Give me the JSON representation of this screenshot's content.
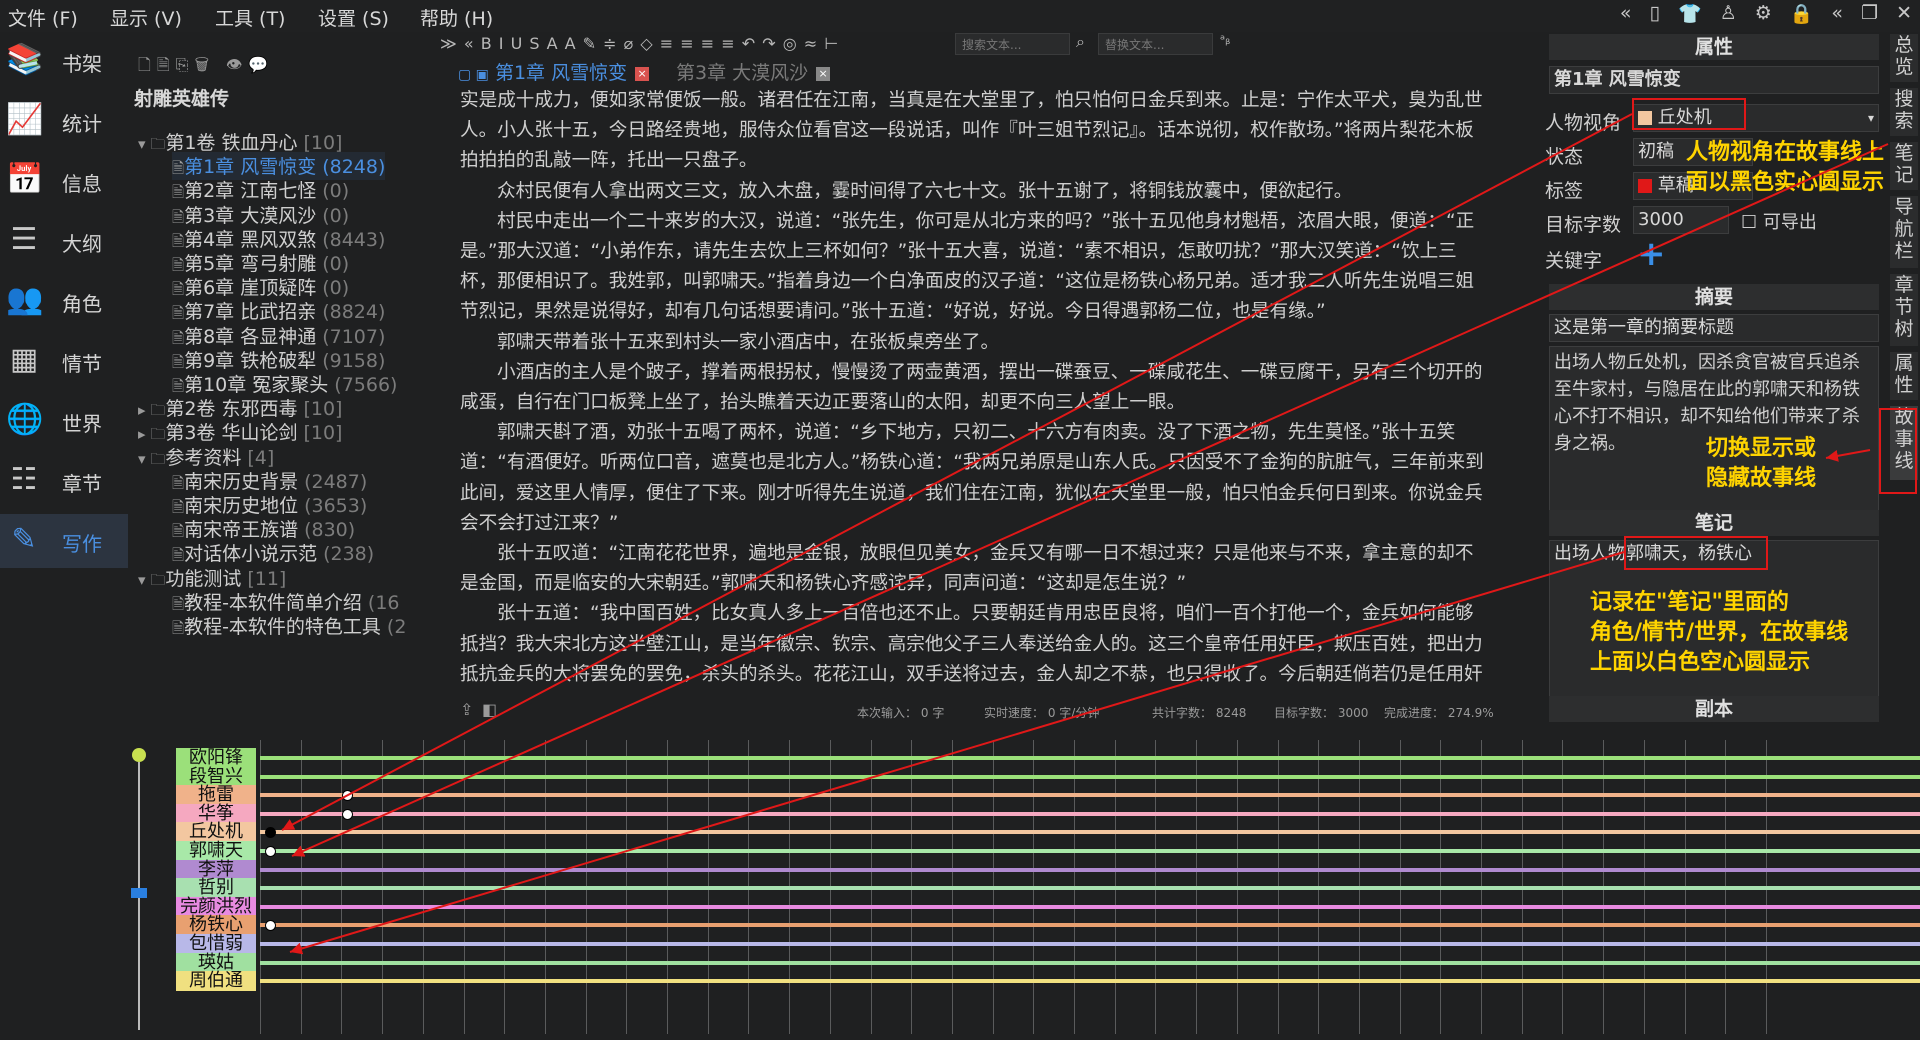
{
  "menu": [
    "文件 (F)",
    "显示 (V)",
    "工具 (T)",
    "设置 (S)",
    "帮助 (H)"
  ],
  "nav": [
    {
      "label": "书架",
      "icon": "bookshelf-icon",
      "glyph": "📚"
    },
    {
      "label": "统计",
      "icon": "chart-icon",
      "glyph": "📈"
    },
    {
      "label": "信息",
      "icon": "calendar-icon",
      "glyph": "📅"
    },
    {
      "label": "大纲",
      "icon": "outline-icon",
      "glyph": "☰"
    },
    {
      "label": "角色",
      "icon": "people-icon",
      "glyph": "👥"
    },
    {
      "label": "情节",
      "icon": "grid-icon",
      "glyph": "▦"
    },
    {
      "label": "世界",
      "icon": "globe-icon",
      "glyph": "🌐"
    },
    {
      "label": "章节",
      "icon": "list-icon",
      "glyph": "☷"
    },
    {
      "label": "写作",
      "icon": "pencil-icon",
      "glyph": "✎"
    }
  ],
  "tree": {
    "title": "射雕英雄传",
    "rows": [
      {
        "text": "第1卷 铁血丹心",
        "cnt": "[10]",
        "indent": 0,
        "arrow": "▾",
        "folder": true
      },
      {
        "text": "第1章 风雪惊变",
        "cnt": "(8248)",
        "indent": 1,
        "sel": true
      },
      {
        "text": "第2章 江南七怪",
        "cnt": "(0)",
        "indent": 1
      },
      {
        "text": "第3章 大漠风沙",
        "cnt": "(0)",
        "indent": 1
      },
      {
        "text": "第4章 黑风双煞",
        "cnt": "(8443)",
        "indent": 1
      },
      {
        "text": "第5章 弯弓射雕",
        "cnt": "(0)",
        "indent": 1
      },
      {
        "text": "第6章 崖顶疑阵",
        "cnt": "(0)",
        "indent": 1
      },
      {
        "text": "第7章 比武招亲",
        "cnt": "(8824)",
        "indent": 1
      },
      {
        "text": "第8章 各显神通",
        "cnt": "(7107)",
        "indent": 1
      },
      {
        "text": "第9章 铁枪破犁",
        "cnt": "(9158)",
        "indent": 1
      },
      {
        "text": "第10章 冤家聚头",
        "cnt": "(7566)",
        "indent": 1
      },
      {
        "text": "第2卷 东邪西毒",
        "cnt": "[10]",
        "indent": 0,
        "arrow": "▸",
        "folder": true
      },
      {
        "text": "第3卷 华山论剑",
        "cnt": "[10]",
        "indent": 0,
        "arrow": "▸",
        "folder": true
      },
      {
        "text": "参考资料",
        "cnt": "[4]",
        "indent": 0,
        "arrow": "▾",
        "folder": true
      },
      {
        "text": "南宋历史背景",
        "cnt": "(2487)",
        "indent": 1
      },
      {
        "text": "南宋历史地位",
        "cnt": "(3653)",
        "indent": 1
      },
      {
        "text": "南宋帝王族谱",
        "cnt": "(830)",
        "indent": 1
      },
      {
        "text": "对话体小说示范",
        "cnt": "(238)",
        "indent": 1
      },
      {
        "text": "功能测试",
        "cnt": "[11]",
        "indent": 0,
        "arrow": "▾",
        "folder": true
      },
      {
        "text": "教程-本软件简单介绍",
        "cnt": "(16",
        "indent": 1
      },
      {
        "text": "教程-本软件的特色工具",
        "cnt": "(2",
        "indent": 1
      }
    ]
  },
  "toolbar": {
    "glyphs": "≫  «  B  I  U  S  A  A  ✎  ≑  ⌀  ◇  ≡  ≡  ≡  ≡  ↶  ↷  ◎  ≈  ⊢",
    "search_placeholder": "搜索文本...",
    "replace_placeholder": "替换文本..."
  },
  "tabs": [
    {
      "label": "第1章 风雪惊变",
      "active": true
    },
    {
      "label": "第3章 大漠风沙",
      "active": false
    }
  ],
  "content": [
    {
      "t": "实是成十成力，便如家常便饭一般。诸君任在江南，当真是在大堂里了，怕只怕何日金兵到来。止是：宁作太平犬，臭为乱世人。小人张十五，今日路经贵地，服侍众位看官这一段说话，叫作『叶三姐节烈记』。话本说彻，权作散场。”将两片梨花木板拍拍拍的乱敲一阵，托出一只盘子。",
      "noindent": true
    },
    {
      "t": "众村民便有人拿出两文三文，放入木盘，霎时间得了六七十文。张十五谢了，将铜钱放囊中，便欲起行。"
    },
    {
      "t": "村民中走出一个二十来岁的大汉，说道：“张先生，你可是从北方来的吗？”张十五见他身材魁梧，浓眉大眼，便道：“正是。”那大汉道：“小弟作东，请先生去饮上三杯如何？”张十五大喜，说道：“素不相识，怎敢叨扰？”那大汉笑道：“饮上三杯，那便相识了。我姓郭，叫郭啸天。”指着身边一个白净面皮的汉子道：“这位是杨铁心杨兄弟。适才我二人听先生说唱三姐节烈记，果然是说得好，却有几句话想要请问。”张十五道：“好说，好说。今日得遇郭杨二位，也是有缘。”"
    },
    {
      "t": "郭啸天带着张十五来到村头一家小酒店中，在张板桌旁坐了。"
    },
    {
      "t": "小酒店的主人是个跛子，撑着两根拐杖，慢慢烫了两壶黄酒，摆出一碟蚕豆、一碟咸花生、一碟豆腐干，另有三个切开的咸蛋，自行在门口板凳上坐了，抬头瞧着天边正要落山的太阳，却更不向三人望上一眼。"
    },
    {
      "t": "郭啸天斟了酒，劝张十五喝了两杯，说道：“乡下地方，只初二、十六方有肉卖。没了下酒之物，先生莫怪。”张十五笑道：“有酒便好。听两位口音，遮莫也是北方人。”杨铁心道：“我两兄弟原是山东人氏。只因受不了金狗的肮脏气，三年前来到此间，爱这里人情厚，便住了下来。刚才听得先生说道，我们住在江南，犹似在天堂里一般，怕只怕金兵何日到来。你说金兵会不会打过江来？”"
    },
    {
      "t": "张十五叹道：“江南花花世界，遍地是金银，放眼但见美女，金兵又有哪一日不想过来？只是他来与不来，拿主意的却不是金国，而是临安的大宋朝廷。”郭啸天和杨铁心齐感诧异，同声问道：“这却是怎生说？”"
    },
    {
      "t": "张十五道：“我中国百姓，比女真人多上一百倍也还不止。只要朝廷肯用忠臣良将，咱们一百个打他一个，金兵如何能够抵挡？我大宋北方这半壁江山，是当年徽宗、钦宗、高宗他父子三人奉送给金人的。这三个皇帝任用奸臣，欺压百姓，把出力抵抗金兵的大将罢免的罢免，杀头的杀头。花花江山，双手送将过去，金人却之不恭，也只得收了。今后朝廷倘若仍是任用奸臣，那就是跪在地下，请金兵驾到，他又如何不来？”郭啸天伸手在桌上重重一拍，只拍得杯儿、筷儿、碟儿都跳将起来。说道：“正是！”"
    }
  ],
  "status": {
    "input_label": "本次输入：",
    "input_val": "0",
    "input_unit": "字",
    "speed_label": "实时速度：",
    "speed_val": "0 字/分钟",
    "total_label": "共计字数：",
    "total_val": "8248",
    "target_label": "目标字数：",
    "target_val": "3000",
    "progress_label": "完成进度：",
    "progress_val": "274.9%"
  },
  "props": {
    "head": "属性",
    "chapter": "第1章 风雪惊变",
    "pov_label": "人物视角",
    "pov_val": "丘处机",
    "state_label": "状态",
    "state_val": "初稿",
    "tag_label": "标签",
    "tag_val": "草稿",
    "target_label": "目标字数",
    "target_val": "3000",
    "export_label": "可导出",
    "kw_label": "关键字",
    "kw_add": "+"
  },
  "summary": {
    "head": "摘要",
    "title": "这是第一章的摘要标题",
    "body": "出场人物丘处机，因杀贪官被官兵追杀至牛家村，与隐居在此的郭啸天和杨铁心不打不相识，却不知给他们带来了杀身之祸。"
  },
  "notes": {
    "head": "笔记",
    "body_prefix": "出场人物",
    "body_names": "郭啸天，杨铁心"
  },
  "copy_head": "副本",
  "sidetabs": [
    "总览",
    "搜索",
    "笔记",
    "导航栏",
    "章节树",
    "属性",
    "故事线"
  ],
  "annotations": {
    "a1_line1": "人物视角在故事线上",
    "a1_line2": "面以黑色实心圆显示",
    "a2_line1": "切换显示或",
    "a2_line2": "隐藏故事线",
    "a3_line1": "记录在\"笔记\"里面的",
    "a3_line2": "角色/情节/世界，在故事线",
    "a3_line3": "上面以白色空心圆显示"
  },
  "storyline": {
    "rows": [
      {
        "name": "欧阳锋",
        "color": "#9be07a"
      },
      {
        "name": "段智兴",
        "color": "#9be07a"
      },
      {
        "name": "拖雷",
        "color": "#f0b28a"
      },
      {
        "name": "华筝",
        "color": "#f5a8c0"
      },
      {
        "name": "丘处机",
        "color": "#f3c7a0"
      },
      {
        "name": "郭啸天",
        "color": "#a8e8a8"
      },
      {
        "name": "李萍",
        "color": "#b08ad0"
      },
      {
        "name": "哲别",
        "color": "#a8e0b0"
      },
      {
        "name": "完颜洪烈",
        "color": "#e78ae0"
      },
      {
        "name": "杨铁心",
        "color": "#e8a070"
      },
      {
        "name": "包惜弱",
        "color": "#b8b8e8"
      },
      {
        "name": "瑛姑",
        "color": "#a0e0a0"
      },
      {
        "name": "周伯通",
        "color": "#f0e080"
      }
    ],
    "dots": [
      {
        "row": 2,
        "col": 2,
        "type": "hollow"
      },
      {
        "row": 3,
        "col": 2,
        "type": "hollow"
      },
      {
        "row": 4,
        "col": 1,
        "type": "filled"
      },
      {
        "row": 5,
        "col": 1,
        "type": "hollow"
      },
      {
        "row": 9,
        "col": 1,
        "type": "hollow"
      }
    ]
  },
  "colors": {
    "accent": "#4a8fe0",
    "annotation": "#ffd400",
    "redbox": "#e01818"
  }
}
